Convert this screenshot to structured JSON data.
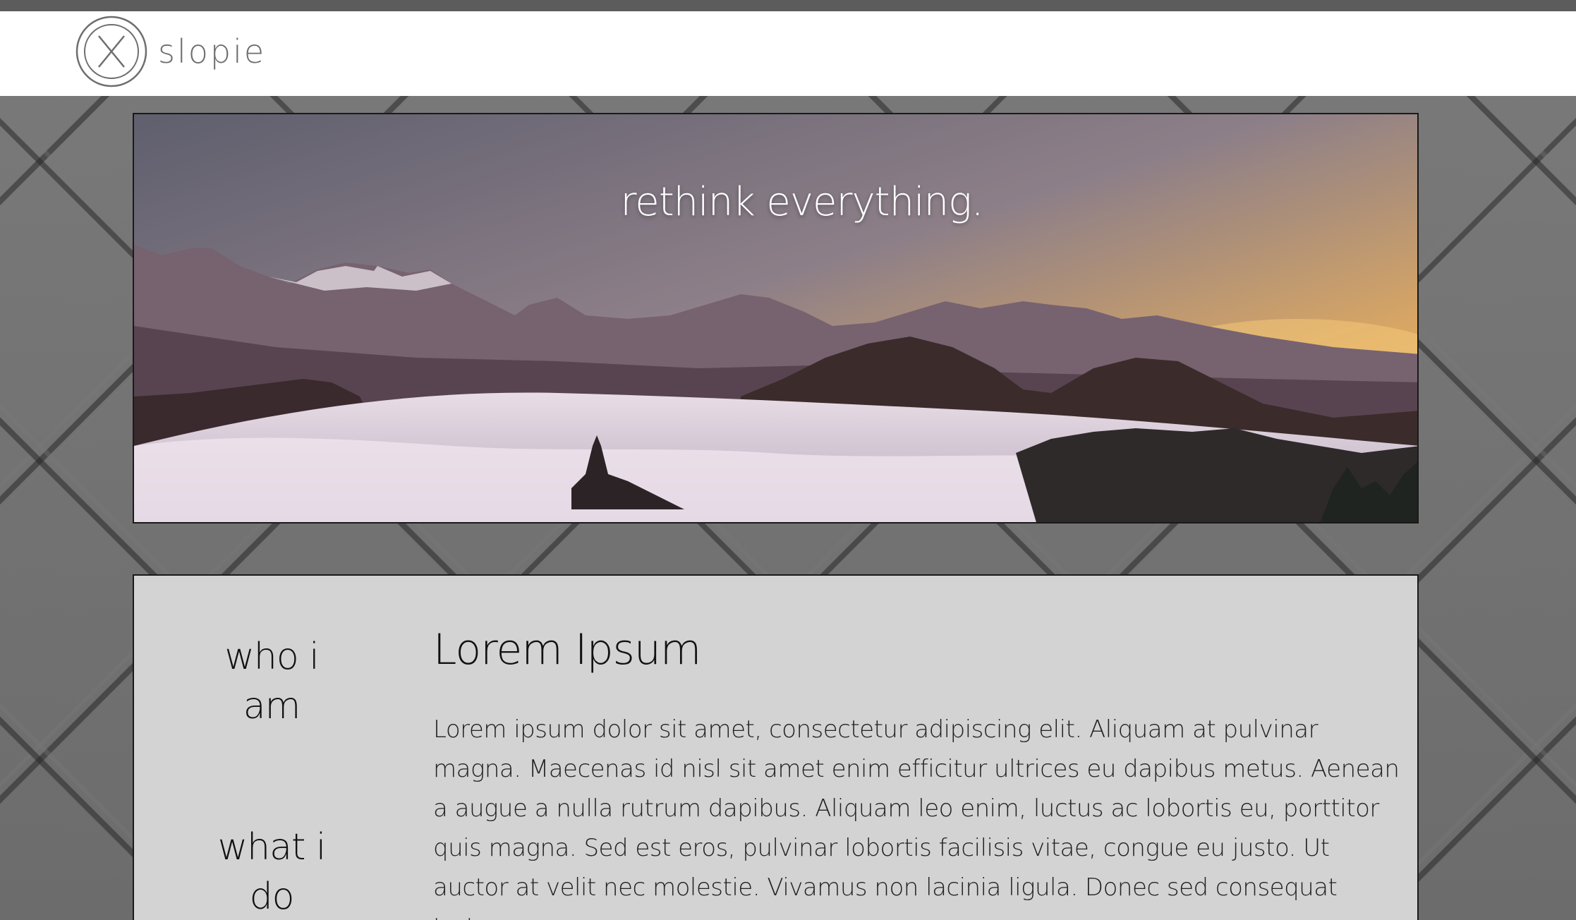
{
  "brand": {
    "name": "slopie",
    "logo_icon": "circle-x-logo-icon"
  },
  "hero": {
    "tagline": "rethink everything."
  },
  "side_nav": {
    "items": [
      {
        "label": "who i am"
      },
      {
        "label": "what i do"
      }
    ]
  },
  "main": {
    "heading": "Lorem Ipsum",
    "body": "Lorem ipsum dolor sit amet, consectetur adipiscing elit. Aliquam at pulvinar magna. Maecenas id nisl sit amet enim efficitur ultrices eu dapibus metus. Aenean a augue a nulla rutrum dapibus. Aliquam leo enim, luctus ac lobortis eu, porttitor quis magna. Sed est eros, pulvinar lobortis facilisis vitae, congue eu justo. Ut auctor at velit nec molestie. Vivamus non lacinia ligula. Donec sed consequat tortor."
  },
  "colors": {
    "navbar_bg": "#ffffff",
    "panel_bg": "#d3d3d3",
    "text_dark": "#111111",
    "logo_gray": "#6e6e6e"
  }
}
